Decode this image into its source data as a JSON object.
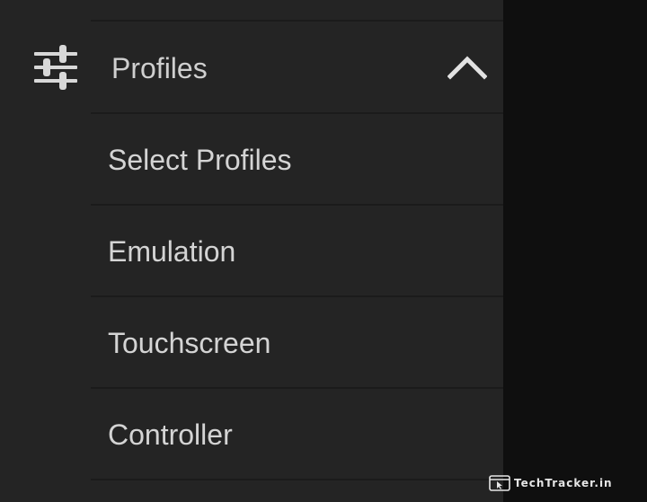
{
  "section": {
    "label": "Profiles",
    "icon": "sliders-icon",
    "expanded_icon": "chevron-up-icon"
  },
  "menu": {
    "items": [
      {
        "label": "Select Profiles"
      },
      {
        "label": "Emulation"
      },
      {
        "label": "Touchscreen"
      },
      {
        "label": "Controller"
      }
    ]
  },
  "watermark": {
    "text": "TechTracker.in",
    "icon": "browser-cursor-icon"
  },
  "colors": {
    "drawer_background": "#242424",
    "page_background": "#0f0f0f",
    "text": "#d4d4d4",
    "divider": "#1b1b1b"
  }
}
